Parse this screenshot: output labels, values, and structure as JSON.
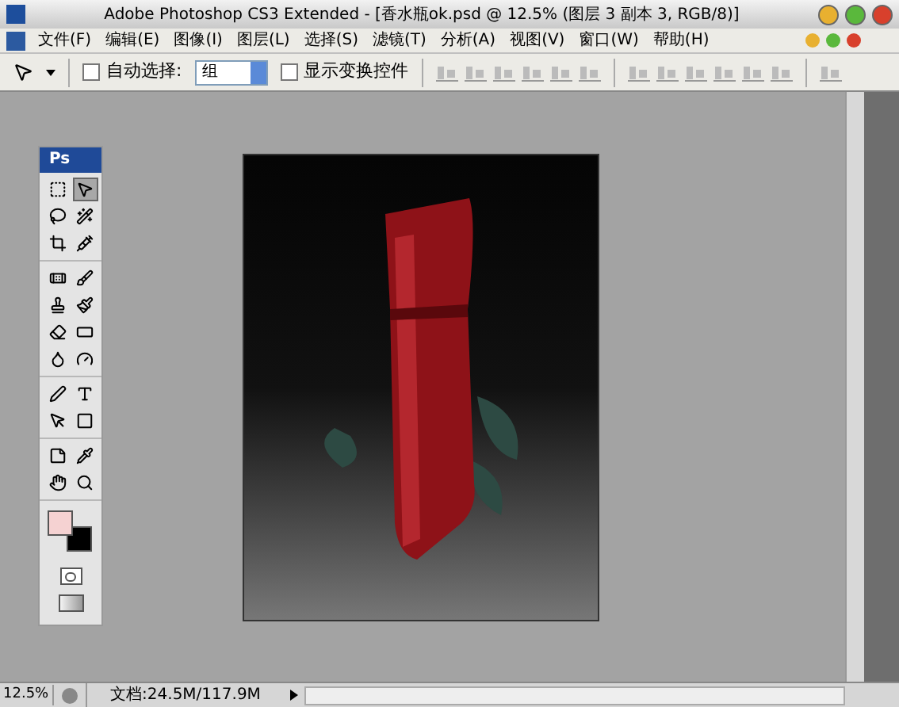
{
  "window": {
    "title": "Adobe Photoshop CS3 Extended - [香水瓶ok.psd @ 12.5% (图层 3 副本 3, RGB/8)]"
  },
  "menu": [
    "文件(F)",
    "编辑(E)",
    "图像(I)",
    "图层(L)",
    "选择(S)",
    "滤镜(T)",
    "分析(A)",
    "视图(V)",
    "窗口(W)",
    "帮助(H)"
  ],
  "options_bar": {
    "auto_select": {
      "label": "自动选择:",
      "checked": false
    },
    "auto_select_target": {
      "value": "组"
    },
    "show_transform": {
      "label": "显示变换控件",
      "checked": false
    }
  },
  "toolbox": {
    "logo": "Ps",
    "groups": [
      [
        {
          "selected": false
        },
        {
          "selected": true
        },
        {
          "selected": false
        },
        {
          "selected": false
        },
        {
          "selected": false
        },
        {
          "selected": false
        }
      ],
      [
        {
          "selected": false
        },
        {
          "selected": false
        },
        {
          "selected": false
        },
        {
          "selected": false
        },
        {
          "selected": false
        },
        {
          "selected": false
        },
        {
          "selected": false
        },
        {
          "selected": false
        }
      ],
      [
        {
          "selected": false
        },
        {
          "selected": false
        },
        {
          "selected": false
        },
        {
          "selected": false
        }
      ],
      [
        {
          "selected": false
        },
        {
          "selected": false
        },
        {
          "selected": false
        },
        {
          "selected": false
        }
      ]
    ],
    "swatches": [
      {
        "kind": "foreground",
        "color": "#f5d2d2"
      },
      {
        "kind": "background",
        "color": "#000000"
      }
    ]
  },
  "status_bar": {
    "zoom": "12.5%",
    "doc_size": "文档:24.5M/117.9M"
  }
}
